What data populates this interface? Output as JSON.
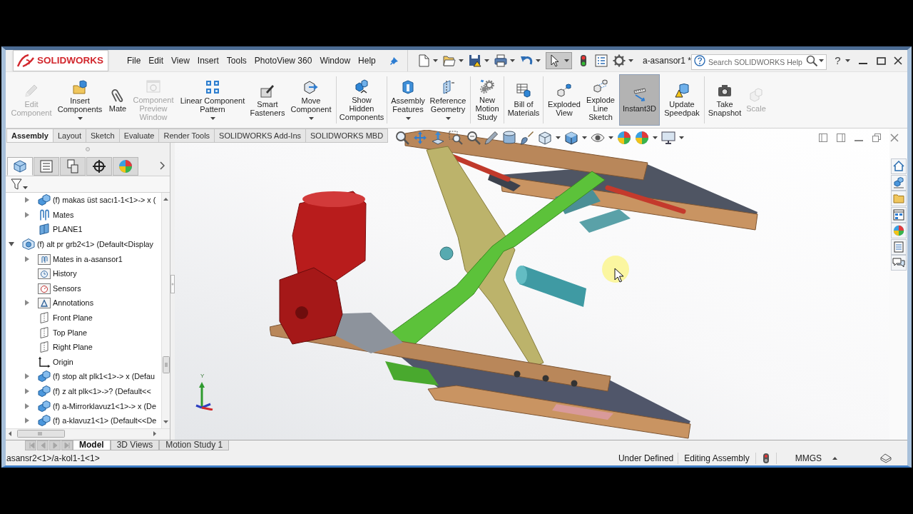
{
  "window": {
    "title": "a-asansor1 *"
  },
  "logo": {
    "name": "SOLIDWORKS"
  },
  "menu": [
    "File",
    "Edit",
    "View",
    "Insert",
    "Tools",
    "PhotoView 360",
    "Window",
    "Help"
  ],
  "quick_access_toolbar": [
    {
      "dropdown": true,
      "selected": false
    },
    {
      "dropdown": true,
      "selected": false
    },
    {
      "dropdown": true,
      "selected": false
    },
    {
      "dropdown": true,
      "selected": false
    },
    {
      "dropdown": true,
      "selected": false
    },
    {
      "dropdown": true,
      "selected": true
    },
    {
      "dropdown": false,
      "selected": false
    },
    {
      "dropdown": false,
      "selected": false
    },
    {
      "dropdown": true,
      "selected": false
    }
  ],
  "search": {
    "placeholder": "Search SOLIDWORKS Help"
  },
  "help_button": {
    "label": "?"
  },
  "command_manager": {
    "groups": [
      [
        {
          "label": "Edit Component",
          "disabled": true,
          "selected": false,
          "dropdown": false
        },
        {
          "label": "Insert Components",
          "disabled": false,
          "selected": false,
          "dropdown": true
        },
        {
          "label": "Mate",
          "disabled": false,
          "selected": false,
          "dropdown": false
        },
        {
          "label": "Component Preview Window",
          "disabled": true,
          "selected": false,
          "dropdown": false
        },
        {
          "label": "Linear Component Pattern",
          "disabled": false,
          "selected": false,
          "dropdown": true
        },
        {
          "label": "Smart Fasteners",
          "disabled": false,
          "selected": false,
          "dropdown": false
        },
        {
          "label": "Move Component",
          "disabled": false,
          "selected": false,
          "dropdown": true
        }
      ],
      [
        {
          "label": "Show Hidden Components",
          "disabled": false,
          "selected": false,
          "dropdown": false
        }
      ],
      [
        {
          "label": "Assembly Features",
          "disabled": false,
          "selected": false,
          "dropdown": true
        },
        {
          "label": "Reference Geometry",
          "disabled": false,
          "selected": false,
          "dropdown": true
        }
      ],
      [
        {
          "label": "New Motion Study",
          "disabled": false,
          "selected": false,
          "dropdown": false
        }
      ],
      [
        {
          "label": "Bill of Materials",
          "disabled": false,
          "selected": false,
          "dropdown": false
        }
      ],
      [
        {
          "label": "Exploded View",
          "disabled": false,
          "selected": false,
          "dropdown": false
        },
        {
          "label": "Explode Line Sketch",
          "disabled": false,
          "selected": false,
          "dropdown": false
        },
        {
          "label": "Instant3D",
          "disabled": false,
          "selected": true,
          "dropdown": false
        },
        {
          "label": "Update Speedpak",
          "disabled": false,
          "selected": false,
          "dropdown": false
        }
      ],
      [
        {
          "label": "Take Snapshot",
          "disabled": false,
          "selected": false,
          "dropdown": false
        },
        {
          "label": "Scale",
          "disabled": true,
          "selected": false,
          "dropdown": false
        }
      ]
    ],
    "tabs": [
      {
        "label": "Assembly",
        "selected": true
      },
      {
        "label": "Layout",
        "selected": false
      },
      {
        "label": "Sketch",
        "selected": false
      },
      {
        "label": "Evaluate",
        "selected": false
      },
      {
        "label": "Render Tools",
        "selected": false
      },
      {
        "label": "SOLIDWORKS Add-Ins",
        "selected": false
      },
      {
        "label": "SOLIDWORKS MBD",
        "selected": false
      }
    ]
  },
  "feature_manager": {
    "tabs": [
      {
        "selected": true
      },
      {
        "selected": false
      },
      {
        "selected": false
      },
      {
        "selected": false
      },
      {
        "selected": false
      }
    ],
    "tree": [
      {
        "children": [
          {
            "kind": "part",
            "label": "(f) makas üst sacı1-1<1>-> x (",
            "expanded": false
          },
          {
            "kind": "mates",
            "label": "Mates",
            "expanded": false
          },
          {
            "kind": "plane",
            "label": "PLANE1"
          }
        ]
      },
      {
        "kind": "assembly",
        "label": "(f) alt pr grb2<1> (Default<Display",
        "expanded": true,
        "children": [
          {
            "kind": "mates_folder",
            "label": "Mates in a-asansor1",
            "expanded": false
          },
          {
            "kind": "history",
            "label": "History"
          },
          {
            "kind": "sensors",
            "label": "Sensors"
          },
          {
            "kind": "annotations",
            "label": "Annotations",
            "expanded": false
          },
          {
            "kind": "ref_plane",
            "label": "Front Plane"
          },
          {
            "kind": "ref_plane",
            "label": "Top Plane"
          },
          {
            "kind": "ref_plane",
            "label": "Right Plane"
          },
          {
            "kind": "origin",
            "label": "Origin"
          },
          {
            "kind": "part",
            "label": "(f) stop alt plk1<1>-> x (Defau",
            "expanded": false
          },
          {
            "kind": "part",
            "label": "(f) z alt plk<1>->? (Default<<",
            "expanded": false
          },
          {
            "kind": "part",
            "label": "(f) a-Mirrorklavuz1<1>-> x (De",
            "expanded": false
          },
          {
            "kind": "part",
            "label": "(f) a-klavuz1<1> (Default<<De",
            "expanded": false
          }
        ]
      }
    ]
  },
  "triad": {
    "label": "Y"
  },
  "tab_scroll_buttons": [
    {
      "disabled": true
    },
    {
      "disabled": true
    },
    {
      "disabled": true
    },
    {
      "disabled": true
    }
  ],
  "bottom_tabs": [
    {
      "label": "Model",
      "selected": true
    },
    {
      "label": "3D Views",
      "selected": false
    },
    {
      "label": "Motion Study 1",
      "selected": false
    }
  ],
  "status_bar": {
    "path": "asansr2<1>/a-kol1-1<1>",
    "items": [
      "Under Defined",
      "Editing Assembly"
    ],
    "units": "MMGS"
  }
}
